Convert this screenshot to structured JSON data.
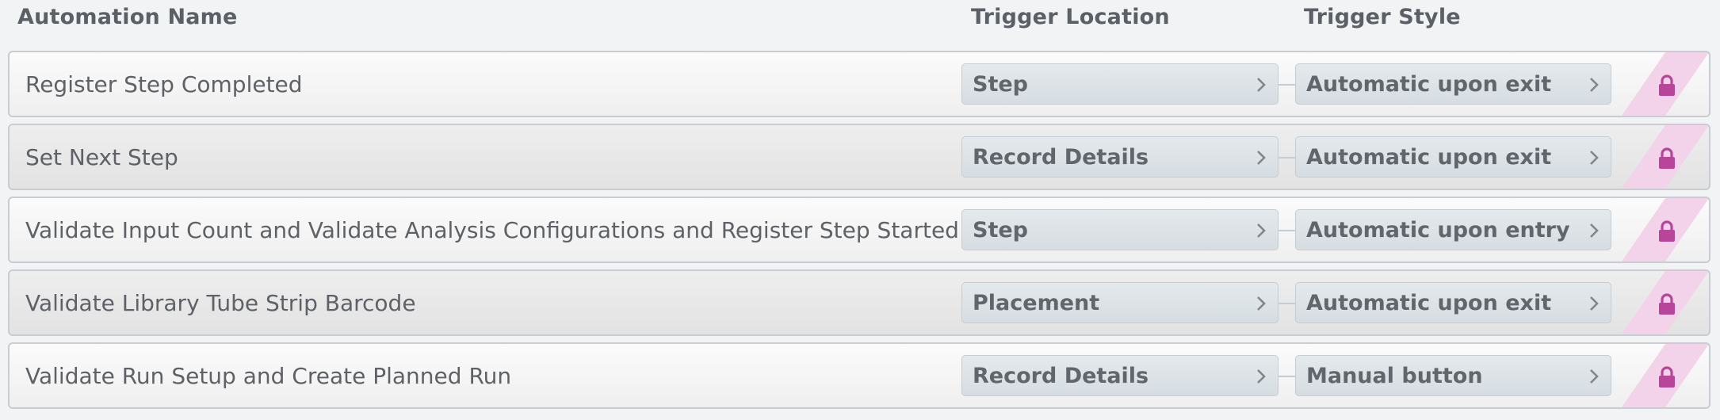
{
  "columns": {
    "name": "Automation Name",
    "location": "Trigger Location",
    "style": "Trigger Style"
  },
  "colors": {
    "lock_accent": "#b8459a",
    "lock_stripe": "#f2d3ea"
  },
  "rows": [
    {
      "name": "Register Step Completed",
      "location": "Step",
      "style": "Automatic upon exit",
      "icon": "lock-icon"
    },
    {
      "name": "Set Next Step",
      "location": "Record Details",
      "style": "Automatic upon exit",
      "icon": "lock-icon"
    },
    {
      "name": "Validate Input Count and Validate Analysis Configurations and Register Step Started",
      "location": "Step",
      "style": "Automatic upon entry",
      "icon": "lock-icon"
    },
    {
      "name": "Validate Library Tube Strip Barcode",
      "location": "Placement",
      "style": "Automatic upon exit",
      "icon": "lock-icon"
    },
    {
      "name": "Validate Run Setup and Create Planned Run",
      "location": "Record Details",
      "style": "Manual button",
      "icon": "lock-icon"
    }
  ]
}
